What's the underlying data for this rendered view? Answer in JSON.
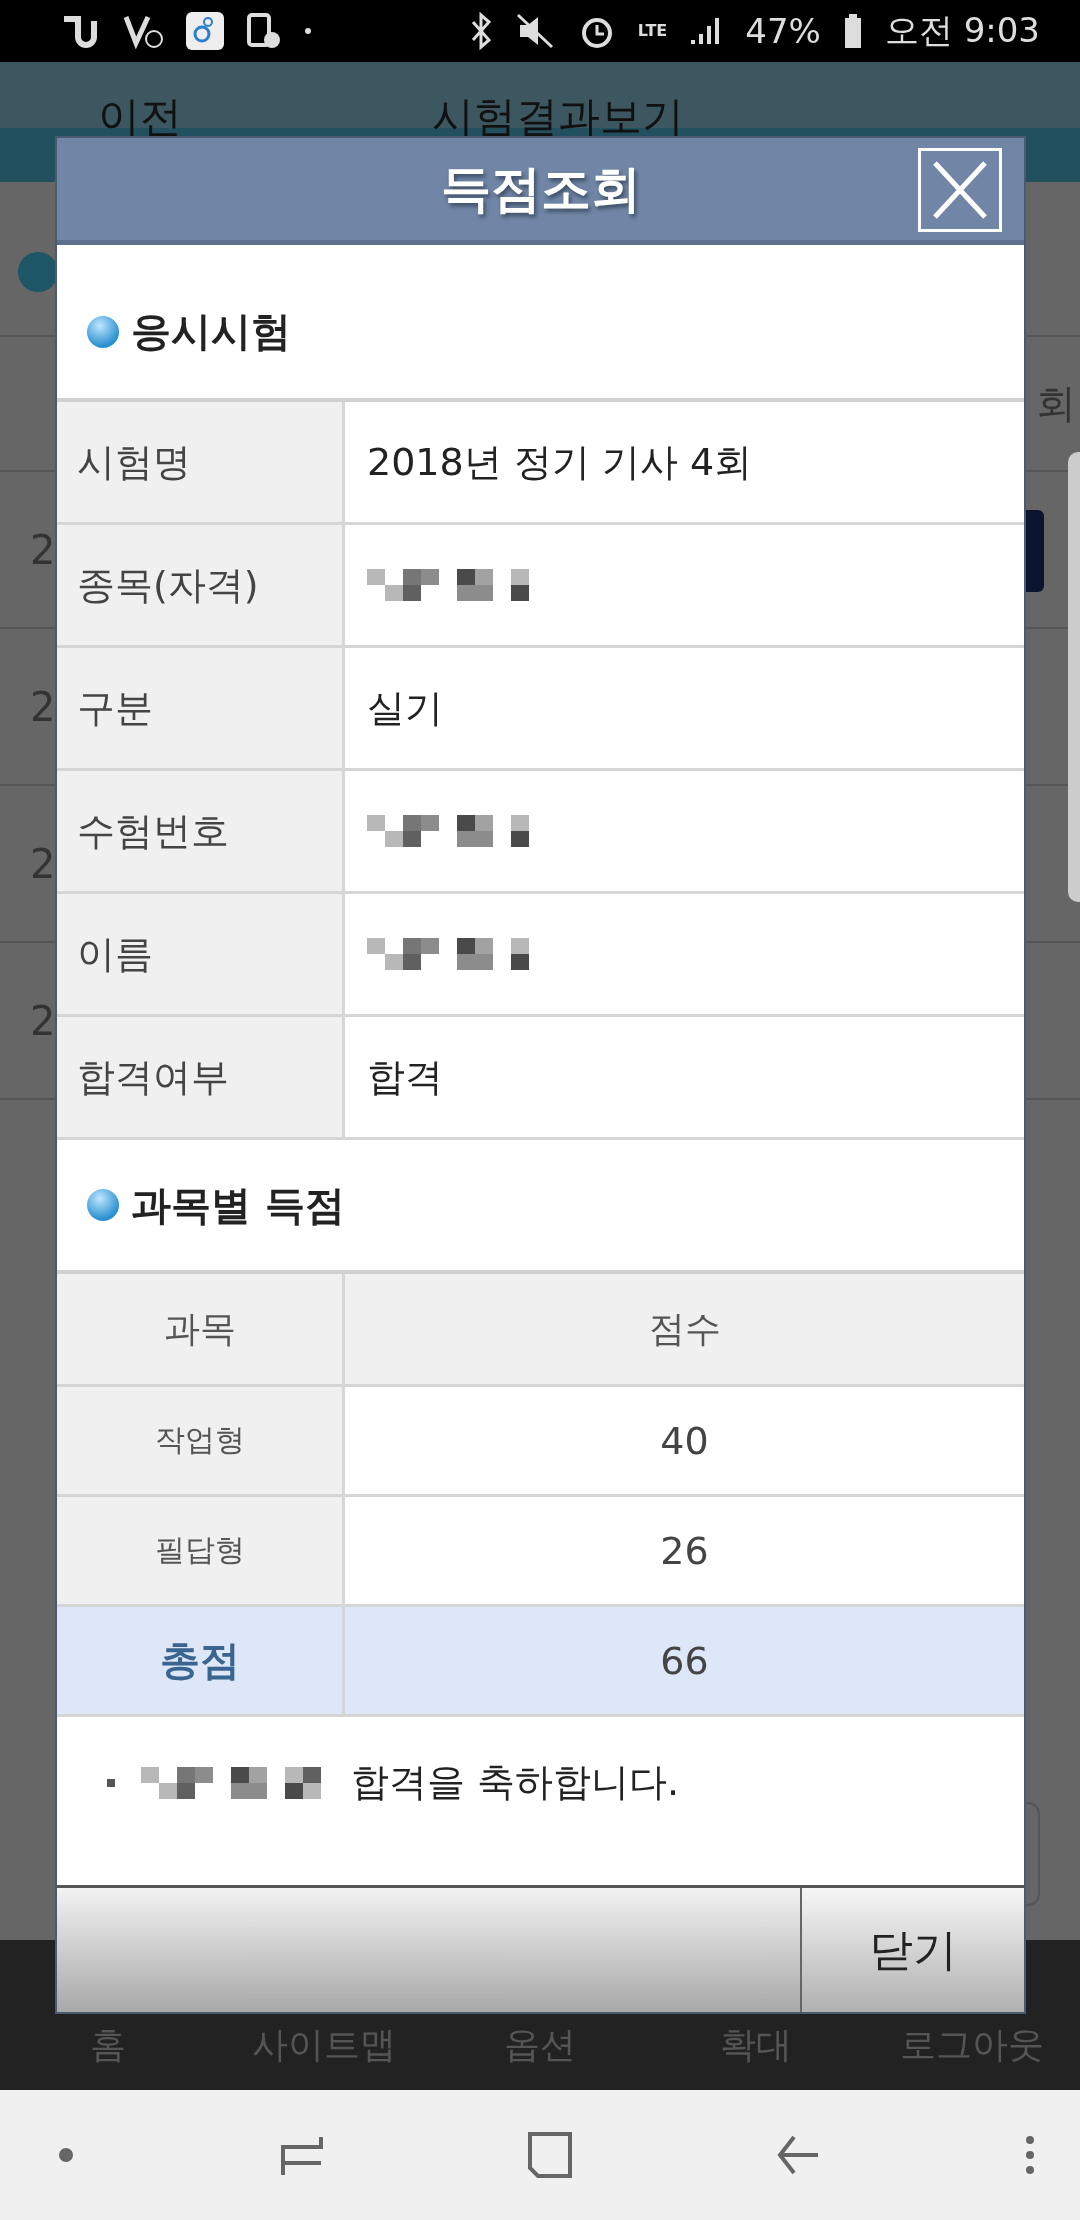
{
  "status_bar": {
    "network": "LTE",
    "battery": "47%",
    "time": "오전 9:03"
  },
  "background": {
    "header": {
      "back": "이전",
      "title": "시험결과보기"
    },
    "table": {
      "header_fragment": "회",
      "row_fragments": [
        "2",
        "2",
        "2",
        "2"
      ]
    },
    "bottom_nav": [
      "홈",
      "사이트맵",
      "옵션",
      "확대",
      "로그아웃"
    ]
  },
  "dialog": {
    "title": "득점조회",
    "exam_section": {
      "title": "응시시험",
      "rows": [
        {
          "label": "시험명",
          "kind": "text",
          "value": "2018년 정기 기사 4회"
        },
        {
          "label": "종목(자격)",
          "kind": "redacted"
        },
        {
          "label": "구분",
          "kind": "text",
          "value": "실기"
        },
        {
          "label": "수험번호",
          "kind": "redacted"
        },
        {
          "label": "이름",
          "kind": "redacted"
        },
        {
          "label": "합격여부",
          "kind": "text",
          "value": "합격"
        }
      ]
    },
    "score_section": {
      "title": "과목별 득점",
      "columns": [
        "과목",
        "점수"
      ],
      "rows": [
        {
          "subject": "작업형",
          "score": "40",
          "kind": "item"
        },
        {
          "subject": "필답형",
          "score": "26",
          "kind": "item"
        },
        {
          "subject": "총점",
          "score": "66",
          "kind": "total"
        }
      ]
    },
    "message": {
      "redacted_prefix": true,
      "text": "합격을 축하합니다."
    },
    "buttons": [
      {
        "label": "닫기"
      }
    ]
  }
}
